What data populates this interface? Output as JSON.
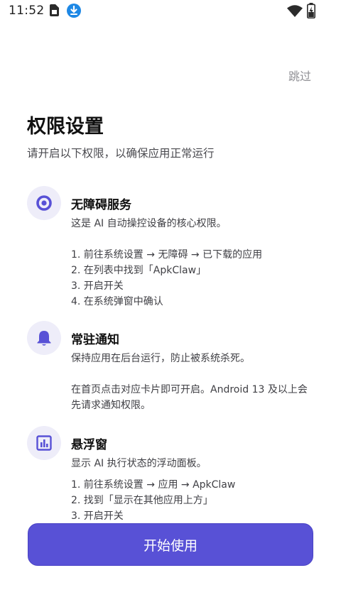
{
  "status_bar": {
    "time": "11:52",
    "icons": [
      "sim-card-icon",
      "download-icon",
      "wifi-icon",
      "battery-charging-icon"
    ]
  },
  "header": {
    "skip_label": "跳过",
    "title": "权限设置",
    "subtitle": "请开启以下权限，以确保应用正常运行"
  },
  "permissions": [
    {
      "icon": "radio-target-icon",
      "title": "无障碍服务",
      "description": "这是 AI 自动操控设备的核心权限。",
      "steps": [
        "1. 前往系统设置 → 无障碍 → 已下载的应用",
        "2. 在列表中找到「ApkClaw」",
        "3. 开启开关",
        "4. 在系统弹窗中确认"
      ]
    },
    {
      "icon": "bell-icon",
      "title": "常驻通知",
      "description": "保持应用在后台运行，防止被系统杀死。",
      "note": "在首页点击对应卡片即可开启。Android 13 及以上会先请求通知权限。"
    },
    {
      "icon": "bar-chart-icon",
      "title": "悬浮窗",
      "description": "显示 AI 执行状态的浮动面板。",
      "steps": [
        "1. 前往系统设置 → 应用 → ApkClaw",
        "2. 找到「显示在其他应用上方」",
        "3. 开启开关"
      ]
    }
  ],
  "footer": {
    "start_label": "开始使用"
  },
  "colors": {
    "accent": "#5851d6",
    "icon_bg": "#eeedf9",
    "skip_text": "#8f8f94"
  }
}
